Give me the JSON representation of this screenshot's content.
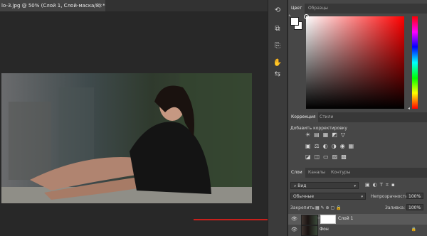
{
  "document": {
    "tab_title": "lo-3.jpg @ 50% (Слой 1, Слой-маска/8) *",
    "close_glyph": "×"
  },
  "strip": {
    "icons": [
      "history-icon",
      "adjust-brush-icon",
      "copy-layer-icon",
      "brush-options-icon",
      "sliders-icon"
    ]
  },
  "color_panel": {
    "tabs": [
      "Цвет",
      "Образцы"
    ],
    "foreground": "#ffffff",
    "background": "#ffffff",
    "hue": "#ff0000"
  },
  "adjust_panel": {
    "tabs": [
      "Коррекция",
      "Стили"
    ],
    "title": "Добавить корректировку",
    "row1": "☀▤▦◩▽",
    "row2": "▣⚖◐◑◉▦",
    "row3": "◪◫▭▨▩"
  },
  "layers_panel": {
    "tabs": [
      "Слои",
      "Каналы",
      "Контуры"
    ],
    "search_kind": "Вид",
    "filter_icons": "▣◐T⌗▪",
    "blend_mode": "Обычные",
    "opacity_label": "Непрозрачность:",
    "opacity_value": "100%",
    "lock_label": "Закрепить:",
    "lock_icons": "▦ ✎ ⊕ ▢ 🔒",
    "fill_label": "Заливка:",
    "fill_value": "100%",
    "layers": [
      {
        "name": "Слой 1",
        "visible": true,
        "selected": true
      },
      {
        "name": "Фон",
        "visible": true,
        "selected": false
      }
    ]
  }
}
